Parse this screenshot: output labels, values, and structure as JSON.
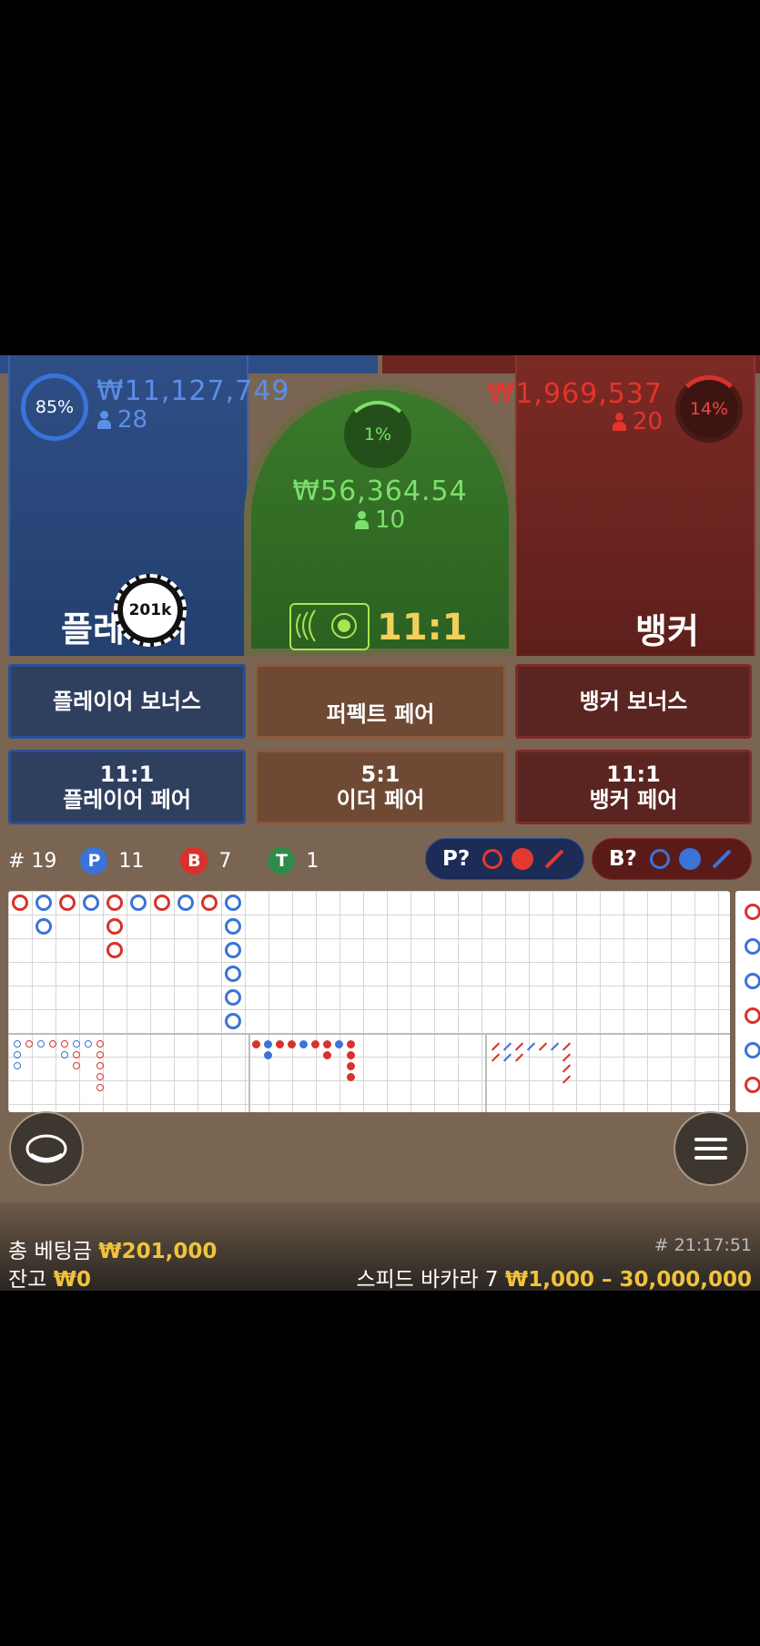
{
  "colors": {
    "player": "#3b73d8",
    "banker": "#d8322b",
    "tie": "#2f8b4a",
    "gold": "#f1c33a",
    "green_text": "#7be06a"
  },
  "player": {
    "percent": "85%",
    "percent_value": 0.85,
    "amount": "₩11,127,749",
    "count": "28",
    "name": "플레이어"
  },
  "banker": {
    "percent": "14%",
    "percent_value": 0.14,
    "amount": "₩1,969,537",
    "count": "20",
    "name": "뱅커"
  },
  "tie": {
    "percent": "1%",
    "percent_value": 0.01,
    "amount": "₩56,364.54",
    "count": "10",
    "payout": "11:1"
  },
  "chip": {
    "label": "201k"
  },
  "bets": {
    "player_bonus": "플레이어 보너스",
    "perfect_pair": "퍼펙트 페어",
    "banker_bonus": "뱅커 보너스",
    "player_pair_odds": "11:1",
    "player_pair": "플레이어 페어",
    "either_pair_odds": "5:1",
    "either_pair": "이더 페어",
    "banker_pair_odds": "11:1",
    "banker_pair": "뱅커 페어"
  },
  "stats": {
    "round": "# 19",
    "p_label": "P",
    "p_count": "11",
    "b_label": "B",
    "b_count": "7",
    "t_label": "T",
    "t_count": "1"
  },
  "predict": {
    "player": "P?",
    "banker": "B?"
  },
  "footer": {
    "total_bet_label": "총 베팅금",
    "total_bet": "₩201,000",
    "balance_label": "잔고",
    "balance": "₩0",
    "round_time": "# 21:17:51",
    "table_name": "스피드 바카라 7",
    "limits": "₩1,000 – 30,000,000"
  },
  "icons": {
    "chat": "chat-bubble-icon",
    "menu": "hamburger-menu-icon",
    "person": "person-icon",
    "tie": "tie-spot-icon"
  }
}
